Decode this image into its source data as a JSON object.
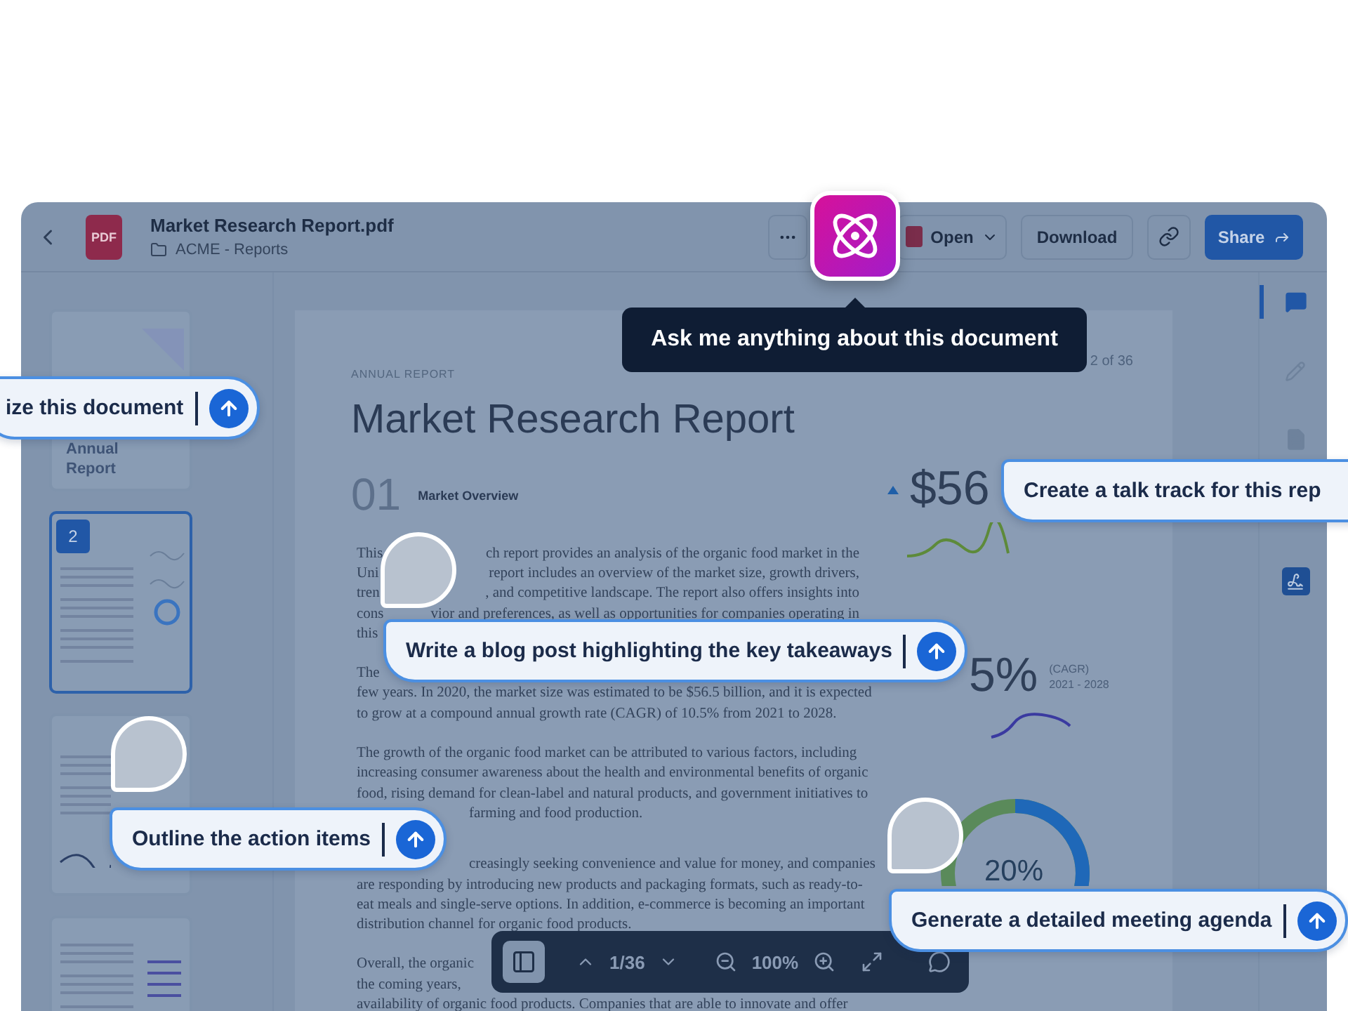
{
  "header": {
    "title": "Market Research Report.pdf",
    "file_badge": "PDF",
    "folder": "ACME - Reports",
    "open_label": "Open",
    "download_label": "Download",
    "share_label": "Share"
  },
  "tooltip": "Ask me anything about this document",
  "thumbnails": [
    {
      "kind": "cover",
      "selected": false,
      "title_lines": [
        "Annual",
        "Report"
      ]
    },
    {
      "kind": "stats",
      "selected": true,
      "badge": "2"
    },
    {
      "kind": "chart",
      "selected": false
    },
    {
      "kind": "text",
      "selected": false
    }
  ],
  "document": {
    "eyebrow": "ANNUAL REPORT",
    "title": "Market Research Report",
    "page_indicator": "2 of 36",
    "section_number": "01",
    "section_title": "Market Overview",
    "paragraphs": [
      {
        "lines": [
          {
            "lead": "This",
            "text": "ch report provides an analysis of the organic food market in the"
          },
          {
            "lead": "Uni",
            "text": "report includes an overview of the market size, growth drivers,"
          },
          {
            "lead": "tren",
            "text": ", and competitive landscape. The report also offers insights into"
          },
          {
            "lead": "cons",
            "text": "vior and preferences, as well as opportunities for companies operating in"
          },
          {
            "text": "this"
          }
        ]
      },
      {
        "lines": [
          {
            "text": "The"
          },
          {
            "text": "few years. In 2020, the market size was estimated to be $56.5 billion, and it is expected"
          },
          {
            "text": "to grow at a compound annual growth rate (CAGR) of 10.5% from 2021 to 2028."
          }
        ]
      },
      {
        "lines": [
          {
            "text": "The growth of the organic food market can be attributed to various factors, including"
          },
          {
            "text": "increasing consumer awareness about the health and environmental benefits of organic"
          },
          {
            "text": "food, rising demand for clean-label and natural products, and government initiatives to"
          },
          {
            "text": "farming and food production.",
            "covered": true
          }
        ]
      },
      {
        "lines": [
          {
            "text": "creasingly seeking convenience and value for money, and companies",
            "covered": true
          },
          {
            "text": "are responding by introducing new products and packaging formats, such as ready-to-"
          },
          {
            "text": "eat meals and single-serve options. In addition, e-commerce is becoming an important"
          },
          {
            "text": "distribution channel for organic food products."
          }
        ]
      },
      {
        "lines": [
          {
            "text": "Overall, the organic"
          },
          {
            "text": "the coming years,"
          },
          {
            "text": "availability of organic food products. Companies that are able to innovate and offer"
          }
        ]
      }
    ],
    "stats": [
      {
        "value": "$56",
        "trend_up": true
      },
      {
        "value": "5%",
        "note": "(CAGR)",
        "range": "2021 - 2028"
      }
    ],
    "donut_label": "20%"
  },
  "rail": [
    {
      "kind": "chat",
      "selected": true
    },
    {
      "kind": "pen",
      "selected": false
    },
    {
      "kind": "document",
      "selected": false
    },
    {
      "kind": "signature",
      "selected": false
    }
  ],
  "toolbar": {
    "page": "1/36",
    "zoom": "100%"
  },
  "prompts": [
    {
      "text": "ize this document"
    },
    {
      "text": "Create a talk track for this rep"
    },
    {
      "text": "Write a blog post highlighting the key takeaways"
    },
    {
      "text": "Outline the action items"
    },
    {
      "text": "Generate a detailed meeting agenda"
    }
  ]
}
